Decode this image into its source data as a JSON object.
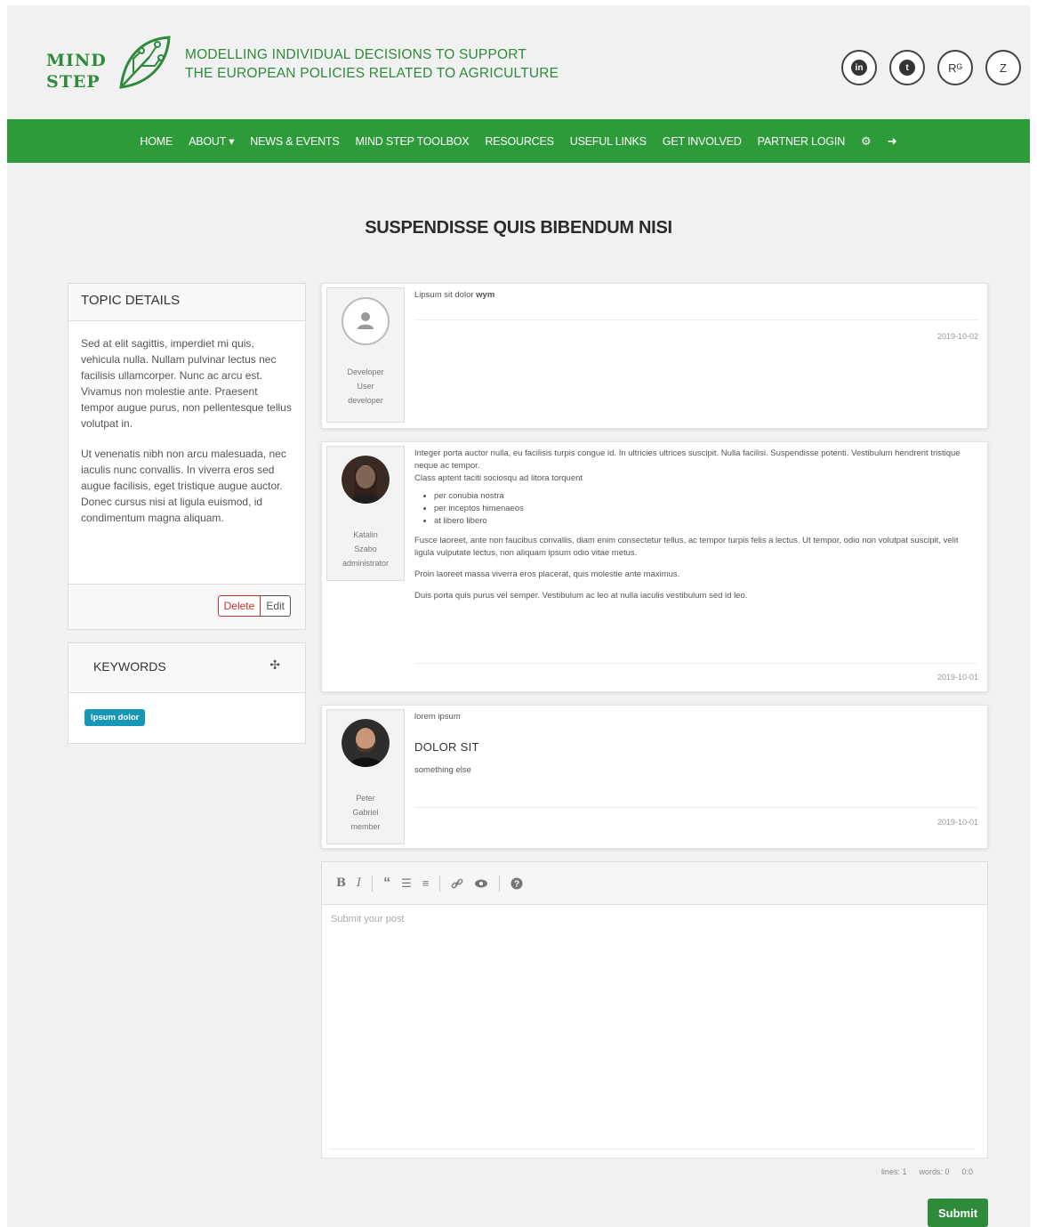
{
  "header": {
    "logo_line1": "MIND",
    "logo_line2": "STEP",
    "tagline_line1": "MODELLING INDIVIDUAL DECISIONS TO SUPPORT",
    "tagline_line2": "THE EUROPEAN POLICIES RELATED TO AGRICULTURE",
    "social": [
      {
        "icon": "linkedin-icon",
        "label": "in"
      },
      {
        "icon": "twitter-icon",
        "label": "t"
      },
      {
        "icon": "researchgate-icon",
        "label": "Rᴳ"
      },
      {
        "icon": "zenodo-icon",
        "label": "Z"
      }
    ]
  },
  "nav": {
    "items": [
      "HOME",
      "ABOUT ▾",
      "NEWS & EVENTS",
      "MIND STEP TOOLBOX",
      "RESOURCES",
      "USEFUL LINKS",
      "GET INVOLVED",
      "PARTNER LOGIN"
    ],
    "icons": [
      "⚙",
      "➜"
    ]
  },
  "page_title": "SUSPENDISSE QUIS BIBENDUM NISI",
  "topic": {
    "heading": "TOPIC DETAILS",
    "paragraph1": "Sed at elit sagittis, imperdiet mi quis, vehicula nulla. Nullam pulvinar lectus nec facilisis ullamcorper. Nunc ac arcu est. Vivamus non molestie ante. Praesent tempor augue purus, non pellentesque tellus volutpat in.",
    "paragraph2": "Ut venenatis nibh non arcu malesuada, nec iaculis nunc convallis. In viverra eros sed augue facilisis, eget tristique augue auctor. Donec cursus nisi at ligula euismod, id condimentum magna aliquam.",
    "delete_label": "Delete",
    "edit_label": "Edit"
  },
  "keywords": {
    "heading": "KEYWORDS",
    "toggle_icon": "✣",
    "badges": [
      "Ipsum dolor"
    ]
  },
  "posts": [
    {
      "avatar_icon": "default-user-icon",
      "author_first": "Developer",
      "author_last": "User",
      "role": "developer",
      "lead": "Lipsum sit dolor ",
      "lead_bold": "wym",
      "date": "2019-10-02"
    },
    {
      "avatar_icon": "woman-avatar",
      "author_first": "Katalin",
      "author_last": "Szabo",
      "role": "administrator",
      "p1": "Integer porta auctor nulla, eu facilisis turpis congue id. In ultricies ultrices suscipit. Nulla facilisi. Suspendisse potenti. Vestibulum hendrerit tristique neque ac tempor.",
      "p1b": "Class aptent taciti sociosqu ad litora torquent",
      "bullets": [
        "per conubia nostra",
        "per inceptos himenaeos",
        "at libero libero"
      ],
      "p2": "Fusce laoreet, ante non faucibus convallis, diam enim consectetur tellus, ac tempor turpis felis a lectus. Ut tempor, odio non volutpat suscipit, velit ligula vulputate lectus, non aliquam ipsum odio vitae metus.",
      "p3": "Proin laoreet massa viverra eros placerat, quis molestie ante maximus.",
      "p4": "Duis porta quis purus vel semper. Vestibulum ac leo at nulla iaculis vestibulum sed id leo.",
      "date": "2019-10-01"
    },
    {
      "avatar_icon": "man-avatar",
      "author_first": "Peter",
      "author_last": "Gabriel",
      "role": "member",
      "lead": "lorem ipsum",
      "heading": "DOLOR SIT",
      "text": "something else",
      "date": "2019-10-01"
    }
  ],
  "editor": {
    "toolbar": [
      "B",
      "I",
      "“",
      "☰",
      "≡",
      "ὑ7",
      "◉",
      "?"
    ],
    "placeholder": "Submit your post",
    "status_lines": "lines: 1",
    "status_words": "words: 0",
    "status_pos": "0:0",
    "submit_label": "Submit"
  },
  "colors": {
    "brand_green": "#2e9b3a",
    "badge_blue": "#1797b8",
    "delete_red": "#c9302c"
  }
}
